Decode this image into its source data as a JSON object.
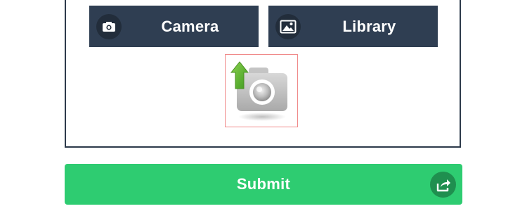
{
  "upload": {
    "camera_button": {
      "label": "Camera",
      "icon": "camera-icon"
    },
    "library_button": {
      "label": "Library",
      "icon": "image-icon"
    },
    "photo_slot": {
      "icon": "camera-upload-icon"
    }
  },
  "submit_button": {
    "label": "Submit",
    "icon": "share-icon"
  },
  "colors": {
    "source_button_bg": "#2f3e52",
    "submit_bg": "#2ecc71",
    "panel_border": "#2d3a4b",
    "slot_border": "#f08a8a",
    "upload_arrow": "#5cb82e"
  }
}
